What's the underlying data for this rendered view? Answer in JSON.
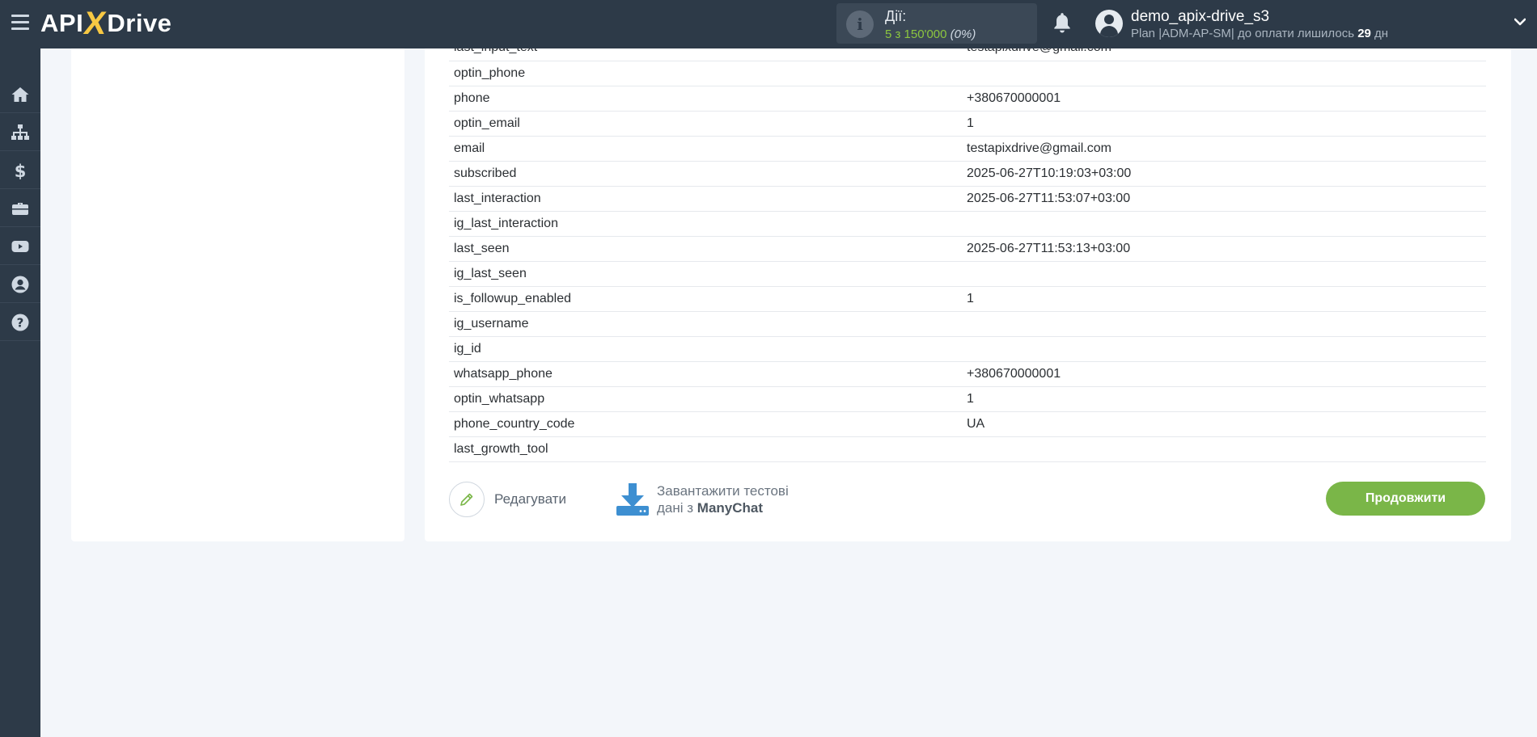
{
  "header": {
    "logo": {
      "left": "API",
      "x": "X",
      "right": "Drive"
    },
    "actions": {
      "label": "Дії:",
      "count": "5 з 150'000",
      "percent": "(0%)"
    },
    "user": {
      "name": "demo_apix-drive_s3",
      "plan_prefix": "Plan |ADM-AP-SM| до оплати лишилось ",
      "days": "29",
      "days_suffix": " дн"
    }
  },
  "sidebar": {
    "items": [
      {
        "icon": "home-icon"
      },
      {
        "icon": "sitemap-icon"
      },
      {
        "icon": "dollar-icon"
      },
      {
        "icon": "briefcase-icon"
      },
      {
        "icon": "youtube-icon"
      },
      {
        "icon": "user-circle-icon"
      },
      {
        "icon": "question-icon"
      }
    ]
  },
  "fields": [
    {
      "key": "last_input_text",
      "value": "testapixdrive@gmail.com"
    },
    {
      "key": "optin_phone",
      "value": ""
    },
    {
      "key": "phone",
      "value": "+380670000001"
    },
    {
      "key": "optin_email",
      "value": "1"
    },
    {
      "key": "email",
      "value": "testapixdrive@gmail.com"
    },
    {
      "key": "subscribed",
      "value": "2025-06-27T10:19:03+03:00"
    },
    {
      "key": "last_interaction",
      "value": "2025-06-27T11:53:07+03:00"
    },
    {
      "key": "ig_last_interaction",
      "value": ""
    },
    {
      "key": "last_seen",
      "value": "2025-06-27T11:53:13+03:00"
    },
    {
      "key": "ig_last_seen",
      "value": ""
    },
    {
      "key": "is_followup_enabled",
      "value": "1"
    },
    {
      "key": "ig_username",
      "value": ""
    },
    {
      "key": "ig_id",
      "value": ""
    },
    {
      "key": "whatsapp_phone",
      "value": "+380670000001"
    },
    {
      "key": "optin_whatsapp",
      "value": "1"
    },
    {
      "key": "phone_country_code",
      "value": "UA"
    },
    {
      "key": "last_growth_tool",
      "value": ""
    }
  ],
  "buttons": {
    "edit": "Редагувати",
    "load_line1": "Завантажити тестові",
    "load_line2_prefix": "дані з ",
    "load_service": "ManyChat",
    "continue": "Продовжити"
  },
  "colors": {
    "header_bg": "#2d3a48",
    "accent_green": "#7ab648",
    "count_green": "#8cc63f",
    "logo_x": "#f7c843",
    "download_blue": "#3d8fd1"
  }
}
